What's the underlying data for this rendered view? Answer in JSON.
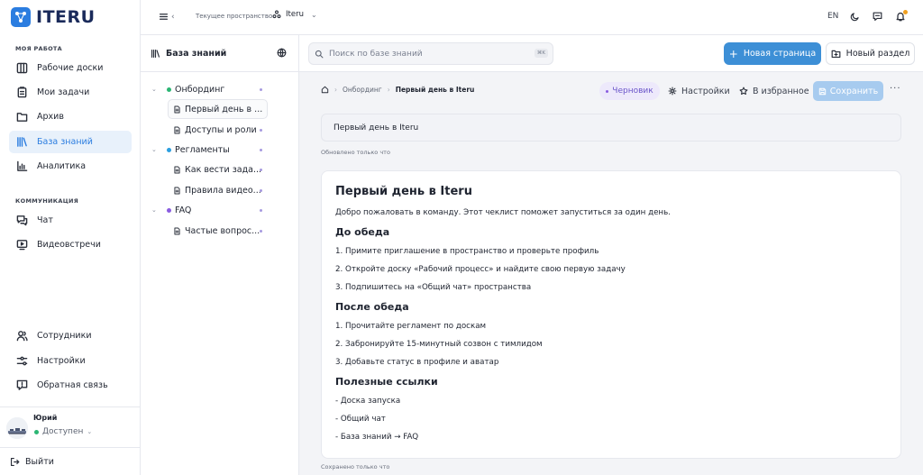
{
  "app": {
    "logo": "ITERU"
  },
  "sidebar": {
    "section_work": "МОЯ РАБОТА",
    "section_comm": "КОММУНИКАЦИЯ",
    "items": [
      {
        "label": "Рабочие доски",
        "icon": "boards-icon"
      },
      {
        "label": "Мои задачи",
        "icon": "tasks-icon"
      },
      {
        "label": "Архив",
        "icon": "archive-icon"
      },
      {
        "label": "База знаний",
        "icon": "library-icon",
        "active": true
      },
      {
        "label": "Аналитика",
        "icon": "analytics-icon"
      }
    ],
    "comm_items": [
      {
        "label": "Чат",
        "icon": "chat-icon"
      },
      {
        "label": "Видеовстречи",
        "icon": "video-icon"
      }
    ],
    "bottom_items": [
      {
        "label": "Сотрудники",
        "icon": "users-icon"
      },
      {
        "label": "Настройки",
        "icon": "settings-icon"
      },
      {
        "label": "Обратная связь",
        "icon": "feedback-icon"
      }
    ],
    "user": {
      "name": "Юрий",
      "status": "Доступен",
      "status_color": "#2bb673"
    },
    "logout": "Выйти"
  },
  "topbar": {
    "space_label": "Текущее пространство",
    "space_name": "Iteru",
    "lang": "EN"
  },
  "tree": {
    "title": "База знаний",
    "nodes": [
      {
        "label": "Онбординг",
        "type": "folder",
        "color": "#2bb673"
      },
      {
        "label": "Первый день в ...",
        "type": "doc",
        "selected": true
      },
      {
        "label": "Доступы и роли",
        "type": "doc"
      },
      {
        "label": "Регламенты",
        "type": "folder",
        "color": "#2b9fe0"
      },
      {
        "label": "Как вести зада...",
        "type": "doc"
      },
      {
        "label": "Правила видео...",
        "type": "doc"
      },
      {
        "label": "FAQ",
        "type": "folder",
        "color": "#8a5ce0"
      },
      {
        "label": "Частые вопрос...",
        "type": "doc"
      }
    ]
  },
  "toolbar": {
    "search_placeholder": "Поиск по базе знаний",
    "search_shortcut": "⌘K",
    "new_page": "Новая страница",
    "new_section": "Новый раздел"
  },
  "page": {
    "breadcrumb": [
      "Онбординг",
      "Первый день в Iteru"
    ],
    "status": "Черновик",
    "settings": "Настройки",
    "favorite": "В избранное",
    "save": "Сохранить",
    "title": "Первый день в Iteru",
    "updated": "Обновлено только что",
    "saved": "Сохранено только что",
    "content": [
      {
        "type": "h1",
        "text": "Первый день в Iteru"
      },
      {
        "type": "p",
        "text": "Добро пожаловать в команду. Этот чеклист поможет запуститься за один день."
      },
      {
        "type": "h2",
        "text": "До обеда"
      },
      {
        "type": "p",
        "text": "1. Примите приглашение в пространство и проверьте профиль"
      },
      {
        "type": "p",
        "text": "2. Откройте доску «Рабочий процесс» и найдите свою первую задачу"
      },
      {
        "type": "p",
        "text": "3. Подпишитесь на «Общий чат» пространства"
      },
      {
        "type": "h2",
        "text": "После обеда"
      },
      {
        "type": "p",
        "text": "1. Прочитайте регламент по доскам"
      },
      {
        "type": "p",
        "text": "2. Забронируйте 15-минутный созвон с тимлидом"
      },
      {
        "type": "p",
        "text": "3. Добавьте статус в профиле и аватар"
      },
      {
        "type": "h2",
        "text": "Полезные ссылки"
      },
      {
        "type": "p",
        "text": "- Доска запуска"
      },
      {
        "type": "p",
        "text": "- Общий чат"
      },
      {
        "type": "p",
        "text": "- База знаний → FAQ"
      }
    ]
  }
}
